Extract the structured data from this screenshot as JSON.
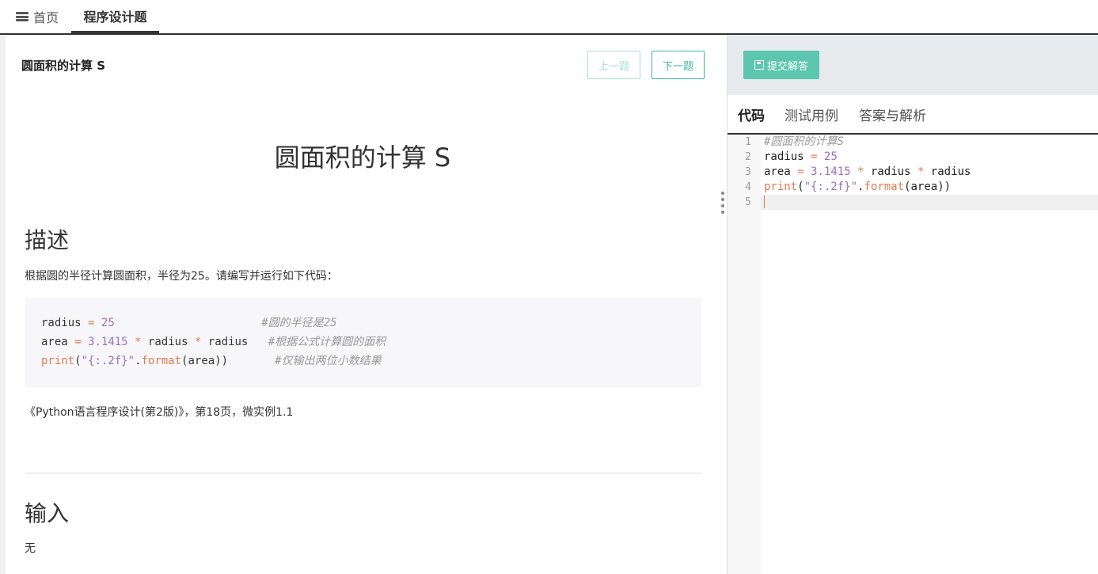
{
  "nav": {
    "home_label": "首页",
    "active_tab": "程序设计题"
  },
  "problem": {
    "title": "圆面积的计算 S",
    "prev_button": "上一题",
    "next_button": "下一题",
    "heading": "圆面积的计算 S",
    "desc_heading": "描述",
    "desc_text": "根据圆的半径计算圆面积，半径为25。请编写并运行如下代码：",
    "code_lines": [
      "radius = 25                      #圆的半径是25",
      "area = 3.1415 * radius * radius   #根据公式计算圆的面积",
      "print(\"{:.2f}\".format(area))       #仅输出两位小数结果"
    ],
    "reference": "《Python语言程序设计(第2版)》，第18页，微实例1.1",
    "input_heading": "输入",
    "input_text": "无"
  },
  "editor": {
    "submit_label": "提交解答",
    "tabs": [
      "代码",
      "测试用例",
      "答案与解析"
    ],
    "line_numbers": [
      "1",
      "2",
      "3",
      "4",
      "5"
    ],
    "code_lines": [
      "#圆面积的计算S",
      "radius = 25",
      "area = 3.1415 * radius * radius",
      "print(\"{:.2f}\".format(area))",
      ""
    ]
  },
  "colors": {
    "accent": "#3bb89c",
    "submit_bg": "#5cc6ae"
  }
}
